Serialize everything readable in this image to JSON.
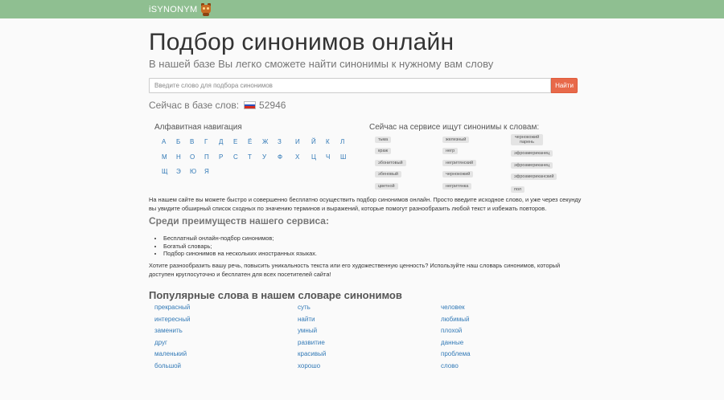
{
  "navbar": {
    "brand": "iSYNONYM",
    "logo_icon": "owl-logo-icon",
    "bg_color": "#8fbf91"
  },
  "header": {
    "title": "Подбор синонимов онлайн",
    "subtitle": "В нашей базе Вы легко сможете найти синонимы к нужному вам слову"
  },
  "search": {
    "placeholder": "Введите слово для подбора синонимов",
    "value": "",
    "button_label": "Найти",
    "button_color": "#e8694a"
  },
  "counter": {
    "label": "Сейчас в базе слов:",
    "value": "52946",
    "flag_icon": "russia-flag-icon"
  },
  "alphabet": {
    "heading": "Алфавитная навигация",
    "rows": [
      [
        "А",
        "Б",
        "В",
        "Г",
        "Д",
        "Е",
        "Ё",
        "Ж",
        "З",
        "И",
        "Й",
        "К",
        "Л"
      ],
      [
        "М",
        "Н",
        "О",
        "П",
        "Р",
        "С",
        "Т",
        "У",
        "Ф",
        "Х",
        "Ц",
        "Ч",
        "Ш"
      ],
      [
        "Щ",
        "Э",
        "Ю",
        "Я"
      ]
    ]
  },
  "now_searching": {
    "heading": "Сейчас на сервисе ищут синонимы к словам:",
    "columns": [
      [
        "тьма",
        "краж",
        "эбонитовый",
        "эбеновый",
        "цветной"
      ],
      [
        "железный",
        "негр",
        "негритянский",
        "чернокожий",
        "негритянка"
      ],
      [
        "чернокожий парень",
        "эфроамериканец",
        "эфроамериканец",
        "эфроамериканский",
        "пол"
      ]
    ]
  },
  "intro": "На нашем сайте вы можете быстро и совершенно бесплатно осуществить подбор синонимов онлайн. Просто введите исходное слово, и уже через секунду вы увидите обширный список сходных по значению терминов и выражений, которые помогут разнообразить любой текст и избежать повторов.",
  "advantages": {
    "heading": "Среди преимуществ нашего сервиса:",
    "items": [
      "Бесплатный онлайн-подбор синонимов;",
      "Богатый словарь;",
      "Подбор синонимов на нескольких иностранных языках."
    ]
  },
  "outro": "Хотите разнообразить вашу речь, повысить уникальность текста или его художественную ценность? Используйте наш словарь синонимов, который доступен круглосуточно и бесплатен для всех посетителей сайта!",
  "popular": {
    "heading": "Популярные слова в нашем словаре синонимов",
    "columns": [
      [
        "прекрасный",
        "интересный",
        "заменить",
        "друг",
        "маленький",
        "большой"
      ],
      [
        "суть",
        "найти",
        "умный",
        "развитие",
        "красивый",
        "хорошо"
      ],
      [
        "человек",
        "любимый",
        "плохой",
        "данные",
        "проблема",
        "слово"
      ]
    ]
  }
}
